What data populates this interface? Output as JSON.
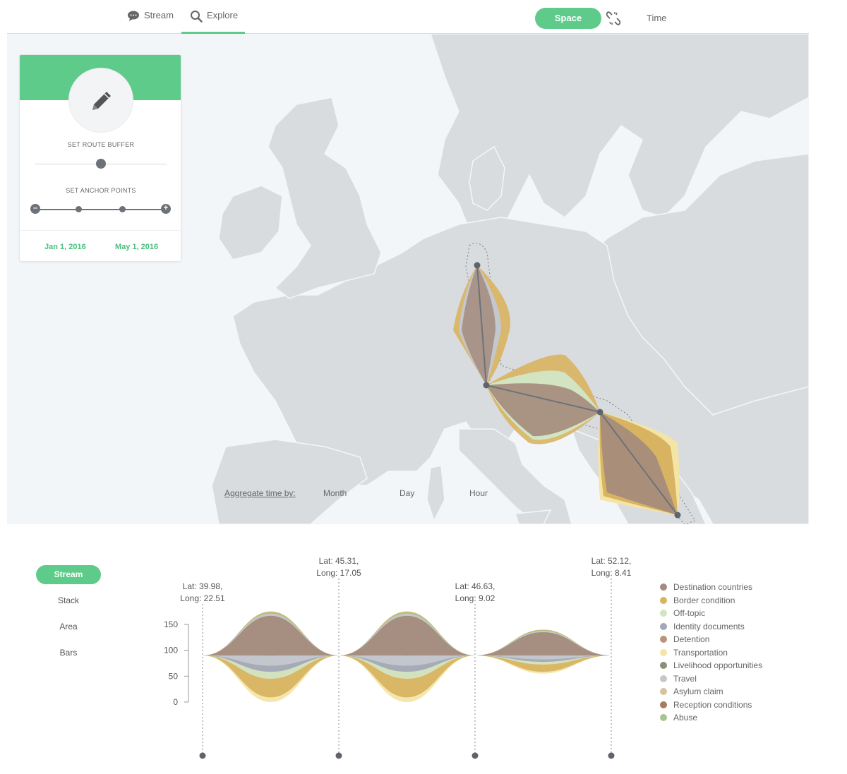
{
  "nav": {
    "tabs": [
      {
        "label": "Stream",
        "icon": "speech-bubble-icon"
      },
      {
        "label": "Explore",
        "icon": "search-icon",
        "active": true
      }
    ],
    "space_label": "Space",
    "time_label": "Time",
    "link_icon": "broken-link-icon"
  },
  "panel": {
    "icon": "pencil-icon",
    "route_buffer_label": "SET ROUTE BUFFER",
    "route_buffer_value": 0.5,
    "anchor_points_label": "SET ANCHOR POINTS",
    "start_date": "Jan 1, 2016",
    "end_date": "May 1, 2016"
  },
  "aggregate": {
    "label": "Aggregate time by:",
    "options": [
      "Month",
      "Day",
      "Hour"
    ]
  },
  "views": [
    "Stream",
    "Stack",
    "Area",
    "Bars"
  ],
  "active_view": "Stream",
  "anchors": [
    {
      "lat": "Lat: 39.98,",
      "long": "Long: 22.51"
    },
    {
      "lat": "Lat: 45.31,",
      "long": "Long: 17.05"
    },
    {
      "lat": "Lat: 46.63,",
      "long": "Long: 9.02"
    },
    {
      "lat": "Lat: 52.12,",
      "long": "Long: 8.41"
    }
  ],
  "colors": {
    "accent": "#5ecb8b",
    "map_land": "#d9dcdf",
    "map_water": "#f3f6f9"
  },
  "chart_data": {
    "type": "area",
    "yticks": [
      0,
      50,
      100,
      150
    ],
    "ylim": [
      0,
      190
    ],
    "baseline": 90,
    "segments": [
      {
        "above": 175,
        "below": 0
      },
      {
        "above": 175,
        "below": 0
      },
      {
        "above": 140,
        "below": 55
      }
    ],
    "series": [
      {
        "name": "Destination countries",
        "color": "#a48b7d"
      },
      {
        "name": "Border condition",
        "color": "#d8b462"
      },
      {
        "name": "Off-topic",
        "color": "#d3e4c3"
      },
      {
        "name": "Identity documents",
        "color": "#a3a8b6"
      },
      {
        "name": "Detention",
        "color": "#b8957a"
      },
      {
        "name": "Transportation",
        "color": "#f4e5a6"
      },
      {
        "name": "Livelihood opportunities",
        "color": "#8b8f78"
      },
      {
        "name": "Travel",
        "color": "#c4c7cc"
      },
      {
        "name": "Asylum claim",
        "color": "#d6c3a2"
      },
      {
        "name": "Reception conditions",
        "color": "#a77b5d"
      },
      {
        "name": "Abuse",
        "color": "#a7c48f"
      }
    ]
  }
}
